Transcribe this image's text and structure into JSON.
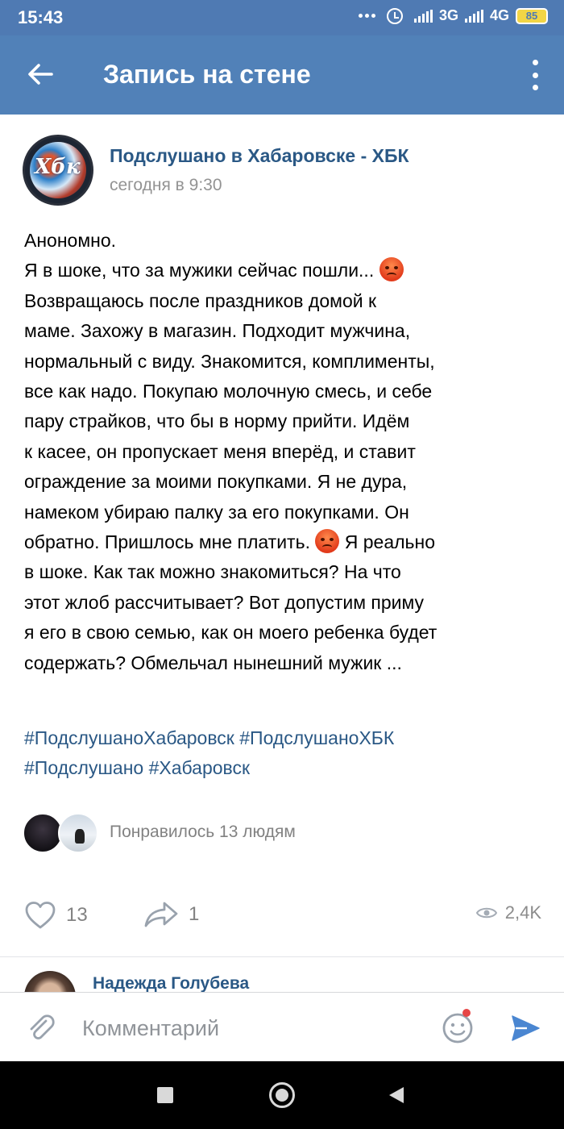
{
  "status_bar": {
    "time": "15:43",
    "network_1": "3G",
    "network_2": "4G",
    "battery": "85"
  },
  "app_bar": {
    "title": "Запись на стене",
    "back_icon": "arrow-left-icon",
    "more_icon": "more-vertical-icon"
  },
  "post": {
    "group_name": "Подслушано в Хабаровске - ХБК",
    "time": "сегодня в 9:30",
    "avatar_text": "Хбк",
    "lines": [
      "Анономно.",
      "Я в шоке, что за мужики сейчас пошли...",
      "Возвращаюсь после праздников домой к",
      "маме. Захожу в магазин. Подходит мужчина,",
      "нормальный с виду. Знакомится, комплименты,",
      "все как надо. Покупаю молочную смесь, и себе",
      "пару страйков, что бы в норму прийти. Идём",
      "к касее, он пропускает меня вперёд, и ставит",
      "ограждение за моими покупками. Я не дура,",
      "намеком убираю палку за его покупками. Он",
      "обратно. Пришлось мне платить.",
      "Я реально",
      "в шоке. Как так можно знакомиться? На что",
      "этот жлоб рассчитывает? Вот допустим приму",
      "я его в свою семью, как он моего ребенка будет",
      "содержать? Обмельчал нынешний мужик ..."
    ],
    "emoji": "angry-face-emoji",
    "hashtags": [
      "#ПодслушаноХабаровск",
      "#ПодслушаноХБК",
      "#Подслушано",
      "#Хабаровск"
    ],
    "likes_text": "Понравилось 13 людям",
    "like_count": "13",
    "share_count": "1",
    "views": "2,4K"
  },
  "comment_preview": {
    "author": "Надежда Голубева"
  },
  "comment_bar": {
    "placeholder": "Комментарий"
  },
  "colors": {
    "status_bar": "#4f7ab3",
    "app_bar": "#5181b8",
    "link": "#2a5885",
    "send": "#4a86d1"
  }
}
